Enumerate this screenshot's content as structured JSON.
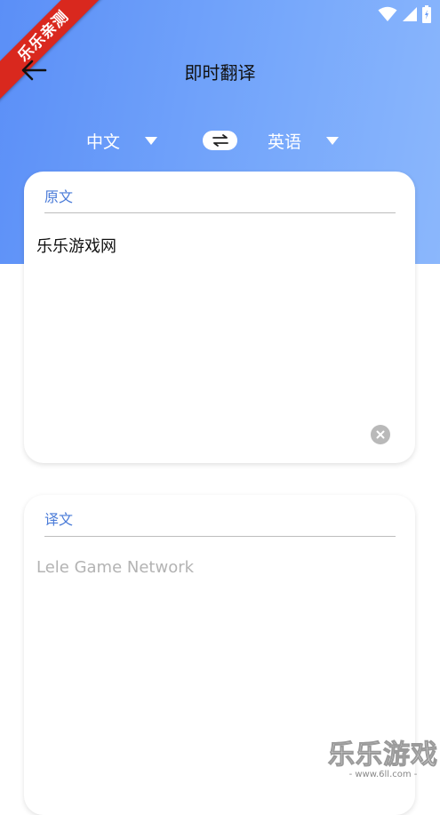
{
  "header": {
    "title": "即时翻译"
  },
  "badge": {
    "text": "乐乐亲测"
  },
  "languages": {
    "source": "中文",
    "target": "英语"
  },
  "source_card": {
    "label": "原文",
    "text": "乐乐游戏网"
  },
  "result_card": {
    "label": "译文",
    "text": "Lele Game Network"
  },
  "watermark": {
    "title": "乐乐游戏",
    "url": "- www.6ll.com -"
  },
  "colors": {
    "accent": "#4a7bd8",
    "header_gradient_start": "#5b8ff7",
    "header_gradient_end": "#8bb7fc",
    "badge": "#d9281e"
  },
  "icons": {
    "back": "back-arrow-icon",
    "swap": "swap-arrows-icon",
    "clear": "clear-icon",
    "dropdown": "caret-down-icon"
  }
}
